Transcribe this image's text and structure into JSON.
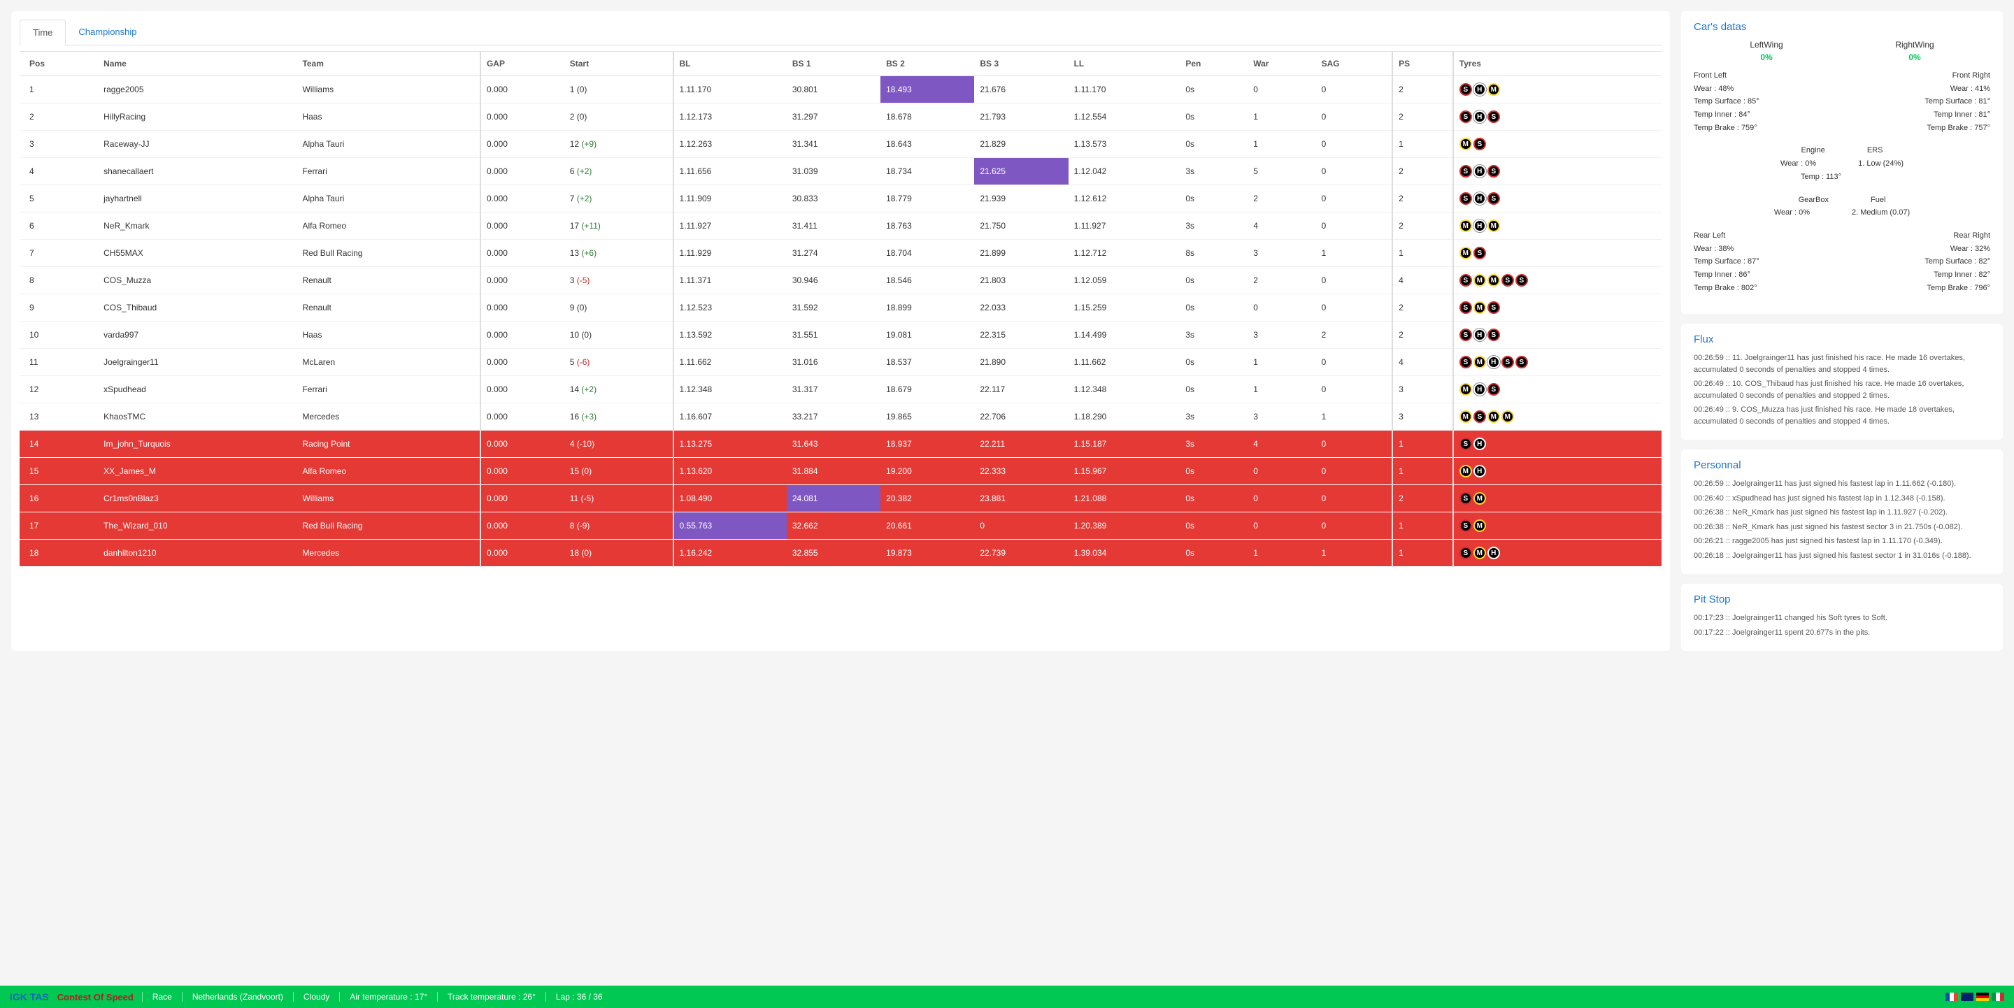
{
  "tabs": {
    "time": "Time",
    "championship": "Championship"
  },
  "headers": [
    "Pos",
    "Name",
    "Team",
    "GAP",
    "Start",
    "BL",
    "BS 1",
    "BS 2",
    "BS 3",
    "LL",
    "Pen",
    "War",
    "SAG",
    "PS",
    "Tyres"
  ],
  "rows": [
    {
      "pos": "1",
      "name": "ragge2005",
      "team": "Williams",
      "gap": "0.000",
      "start": "1",
      "delta": "(0)",
      "bl": "1.11.170",
      "bs1": "30.801",
      "bs2": "18.493",
      "bs3": "21.676",
      "ll": "1.11.170",
      "pen": "0s",
      "war": "0",
      "sag": "0",
      "ps": "2",
      "tyres": [
        "S",
        "H",
        "M"
      ],
      "red": false,
      "purple": [
        "bs2"
      ]
    },
    {
      "pos": "2",
      "name": "HillyRacing",
      "team": "Haas",
      "gap": "0.000",
      "start": "2",
      "delta": "(0)",
      "bl": "1.12.173",
      "bs1": "31.297",
      "bs2": "18.678",
      "bs3": "21.793",
      "ll": "1.12.554",
      "pen": "0s",
      "war": "1",
      "sag": "0",
      "ps": "2",
      "tyres": [
        "S",
        "H",
        "S"
      ],
      "red": false,
      "purple": []
    },
    {
      "pos": "3",
      "name": "Raceway-JJ",
      "team": "Alpha Tauri",
      "gap": "0.000",
      "start": "12",
      "delta": "(+9)",
      "bl": "1.12.263",
      "bs1": "31.341",
      "bs2": "18.643",
      "bs3": "21.829",
      "ll": "1.13.573",
      "pen": "0s",
      "war": "1",
      "sag": "0",
      "ps": "1",
      "tyres": [
        "M",
        "S"
      ],
      "red": false,
      "purple": []
    },
    {
      "pos": "4",
      "name": "shanecallaert",
      "team": "Ferrari",
      "gap": "0.000",
      "start": "6",
      "delta": "(+2)",
      "bl": "1.11.656",
      "bs1": "31.039",
      "bs2": "18.734",
      "bs3": "21.625",
      "ll": "1.12.042",
      "pen": "3s",
      "war": "5",
      "sag": "0",
      "ps": "2",
      "tyres": [
        "S",
        "H",
        "S"
      ],
      "red": false,
      "purple": [
        "bs3"
      ]
    },
    {
      "pos": "5",
      "name": "jayhartnell",
      "team": "Alpha Tauri",
      "gap": "0.000",
      "start": "7",
      "delta": "(+2)",
      "bl": "1.11.909",
      "bs1": "30.833",
      "bs2": "18.779",
      "bs3": "21.939",
      "ll": "1.12.612",
      "pen": "0s",
      "war": "2",
      "sag": "0",
      "ps": "2",
      "tyres": [
        "S",
        "H",
        "S"
      ],
      "red": false,
      "purple": []
    },
    {
      "pos": "6",
      "name": "NeR_Kmark",
      "team": "Alfa Romeo",
      "gap": "0.000",
      "start": "17",
      "delta": "(+11)",
      "bl": "1.11.927",
      "bs1": "31.411",
      "bs2": "18.763",
      "bs3": "21.750",
      "ll": "1.11.927",
      "pen": "3s",
      "war": "4",
      "sag": "0",
      "ps": "2",
      "tyres": [
        "M",
        "H",
        "M"
      ],
      "red": false,
      "purple": []
    },
    {
      "pos": "7",
      "name": "CH55MAX",
      "team": "Red Bull Racing",
      "gap": "0.000",
      "start": "13",
      "delta": "(+6)",
      "bl": "1.11.929",
      "bs1": "31.274",
      "bs2": "18.704",
      "bs3": "21.899",
      "ll": "1.12.712",
      "pen": "8s",
      "war": "3",
      "sag": "1",
      "ps": "1",
      "tyres": [
        "M",
        "S"
      ],
      "red": false,
      "purple": []
    },
    {
      "pos": "8",
      "name": "COS_Muzza",
      "team": "Renault",
      "gap": "0.000",
      "start": "3",
      "delta": "(-5)",
      "bl": "1.11.371",
      "bs1": "30.946",
      "bs2": "18.546",
      "bs3": "21.803",
      "ll": "1.12.059",
      "pen": "0s",
      "war": "2",
      "sag": "0",
      "ps": "4",
      "tyres": [
        "S",
        "M",
        "M",
        "S",
        "S"
      ],
      "red": false,
      "purple": []
    },
    {
      "pos": "9",
      "name": "COS_Thibaud",
      "team": "Renault",
      "gap": "0.000",
      "start": "9",
      "delta": "(0)",
      "bl": "1.12.523",
      "bs1": "31.592",
      "bs2": "18.899",
      "bs3": "22.033",
      "ll": "1.15.259",
      "pen": "0s",
      "war": "0",
      "sag": "0",
      "ps": "2",
      "tyres": [
        "S",
        "M",
        "S"
      ],
      "red": false,
      "purple": []
    },
    {
      "pos": "10",
      "name": "varda997",
      "team": "Haas",
      "gap": "0.000",
      "start": "10",
      "delta": "(0)",
      "bl": "1.13.592",
      "bs1": "31.551",
      "bs2": "19.081",
      "bs3": "22.315",
      "ll": "1.14.499",
      "pen": "3s",
      "war": "3",
      "sag": "2",
      "ps": "2",
      "tyres": [
        "S",
        "H",
        "S"
      ],
      "red": false,
      "purple": []
    },
    {
      "pos": "11",
      "name": "Joelgrainger11",
      "team": "McLaren",
      "gap": "0.000",
      "start": "5",
      "delta": "(-6)",
      "bl": "1.11.662",
      "bs1": "31.016",
      "bs2": "18.537",
      "bs3": "21.890",
      "ll": "1.11.662",
      "pen": "0s",
      "war": "1",
      "sag": "0",
      "ps": "4",
      "tyres": [
        "S",
        "M",
        "H",
        "S",
        "S"
      ],
      "red": false,
      "purple": []
    },
    {
      "pos": "12",
      "name": "xSpudhead",
      "team": "Ferrari",
      "gap": "0.000",
      "start": "14",
      "delta": "(+2)",
      "bl": "1.12.348",
      "bs1": "31.317",
      "bs2": "18.679",
      "bs3": "22.117",
      "ll": "1.12.348",
      "pen": "0s",
      "war": "1",
      "sag": "0",
      "ps": "3",
      "tyres": [
        "M",
        "H",
        "S"
      ],
      "red": false,
      "purple": []
    },
    {
      "pos": "13",
      "name": "KhaosTMC",
      "team": "Mercedes",
      "gap": "0.000",
      "start": "16",
      "delta": "(+3)",
      "bl": "1.16.607",
      "bs1": "33.217",
      "bs2": "19.865",
      "bs3": "22.706",
      "ll": "1.18.290",
      "pen": "3s",
      "war": "3",
      "sag": "1",
      "ps": "3",
      "tyres": [
        "M",
        "S",
        "M",
        "M"
      ],
      "red": false,
      "purple": []
    },
    {
      "pos": "14",
      "name": "Im_john_Turquois",
      "team": "Racing Point",
      "gap": "0.000",
      "start": "4",
      "delta": "(-10)",
      "bl": "1.13.275",
      "bs1": "31.643",
      "bs2": "18.937",
      "bs3": "22.211",
      "ll": "1.15.187",
      "pen": "3s",
      "war": "4",
      "sag": "0",
      "ps": "1",
      "tyres": [
        "S",
        "H"
      ],
      "red": true,
      "purple": []
    },
    {
      "pos": "15",
      "name": "XX_James_M",
      "team": "Alfa Romeo",
      "gap": "0.000",
      "start": "15",
      "delta": "(0)",
      "bl": "1.13.620",
      "bs1": "31.884",
      "bs2": "19.200",
      "bs3": "22.333",
      "ll": "1.15.967",
      "pen": "0s",
      "war": "0",
      "sag": "0",
      "ps": "1",
      "tyres": [
        "M",
        "H"
      ],
      "red": true,
      "purple": []
    },
    {
      "pos": "16",
      "name": "Cr1ms0nBlaz3",
      "team": "Williams",
      "gap": "0.000",
      "start": "11",
      "delta": "(-5)",
      "bl": "1.08.490",
      "bs1": "24.081",
      "bs2": "20.382",
      "bs3": "23.881",
      "ll": "1.21.088",
      "pen": "0s",
      "war": "0",
      "sag": "0",
      "ps": "2",
      "tyres": [
        "S",
        "M"
      ],
      "red": true,
      "purple": [
        "bs1"
      ]
    },
    {
      "pos": "17",
      "name": "The_Wizard_010",
      "team": "Red Bull Racing",
      "gap": "0.000",
      "start": "8",
      "delta": "(-9)",
      "bl": "0.55.763",
      "bs1": "32.662",
      "bs2": "20.661",
      "bs3": "0",
      "ll": "1.20.389",
      "pen": "0s",
      "war": "0",
      "sag": "0",
      "ps": "1",
      "tyres": [
        "S",
        "M"
      ],
      "red": true,
      "purple": [
        "bl"
      ]
    },
    {
      "pos": "18",
      "name": "danhilton1210",
      "team": "Mercedes",
      "gap": "0.000",
      "start": "18",
      "delta": "(0)",
      "bl": "1.16.242",
      "bs1": "32.855",
      "bs2": "19.873",
      "bs3": "22.739",
      "ll": "1.39.034",
      "pen": "0s",
      "war": "1",
      "sag": "1",
      "ps": "1",
      "tyres": [
        "S",
        "M",
        "H"
      ],
      "red": true,
      "purple": []
    }
  ],
  "car": {
    "title": "Car's datas",
    "leftWing": {
      "label": "LeftWing",
      "value": "0%"
    },
    "rightWing": {
      "label": "RightWing",
      "value": "0%"
    },
    "fl": {
      "title": "Front Left",
      "wear": "Wear : 48%",
      "ts": "Temp Surface : 85°",
      "ti": "Temp Inner : 84°",
      "tb": "Temp Brake : 759°"
    },
    "fr": {
      "title": "Front Right",
      "wear": "Wear : 41%",
      "ts": "Temp Surface : 81°",
      "ti": "Temp Inner : 81°",
      "tb": "Temp Brake : 757°"
    },
    "engine": {
      "title": "Engine",
      "wear": "Wear : 0%",
      "temp": "Temp : 113°"
    },
    "ers": {
      "title": "ERS",
      "mode": "1. Low (24%)"
    },
    "gearbox": {
      "title": "GearBox",
      "wear": "Wear : 0%"
    },
    "fuel": {
      "title": "Fuel",
      "mode": "2. Medium (0.07)"
    },
    "rl": {
      "title": "Rear Left",
      "wear": "Wear : 38%",
      "ts": "Temp Surface : 87°",
      "ti": "Temp Inner : 86°",
      "tb": "Temp Brake : 802°"
    },
    "rr": {
      "title": "Rear Right",
      "wear": "Wear : 32%",
      "ts": "Temp Surface : 82°",
      "ti": "Temp Inner : 82°",
      "tb": "Temp Brake : 796°"
    }
  },
  "flux": {
    "title": "Flux",
    "items": [
      "00:26:59 :: 11. Joelgrainger11 has just finished his race. He made 16 overtakes, accumulated 0 seconds of penalties and stopped 4 times.",
      "00:26:49 :: 10. COS_Thibaud has just finished his race. He made 16 overtakes, accumulated 0 seconds of penalties and stopped 2 times.",
      "00:26:49 :: 9. COS_Muzza has just finished his race. He made 18 overtakes, accumulated 0 seconds of penalties and stopped 4 times."
    ]
  },
  "personal": {
    "title": "Personnal",
    "items": [
      "00:26:59 :: Joelgrainger11 has just signed his fastest lap in 1.11.662 (-0.180).",
      "00:26:40 :: xSpudhead has just signed his fastest lap in 1.12.348 (-0.158).",
      "00:26:38 :: NeR_Kmark has just signed his fastest lap in 1.11.927 (-0.202).",
      "00:26:38 :: NeR_Kmark has just signed his fastest sector 3 in 21.750s (-0.082).",
      "00:26:21 :: ragge2005 has just signed his fastest lap in 1.11.170 (-0.349).",
      "00:26:18 :: Joelgrainger11 has just signed his fastest sector 1 in 31.016s (-0.188)."
    ]
  },
  "pitstop": {
    "title": "Pit Stop",
    "items": [
      "00:17:23 :: Joelgrainger11 changed his Soft tyres to Soft.",
      "00:17:22 :: Joelgrainger11 spent 20.677s in the pits."
    ]
  },
  "footer": {
    "brand1": "IGK TAS",
    "brand2": "Contest Of Speed",
    "chips": [
      "Race",
      "Netherlands (Zandvoort)",
      "Cloudy",
      "Air temperature : 17°",
      "Track temperature : 26°",
      "Lap : 36 / 36"
    ]
  }
}
